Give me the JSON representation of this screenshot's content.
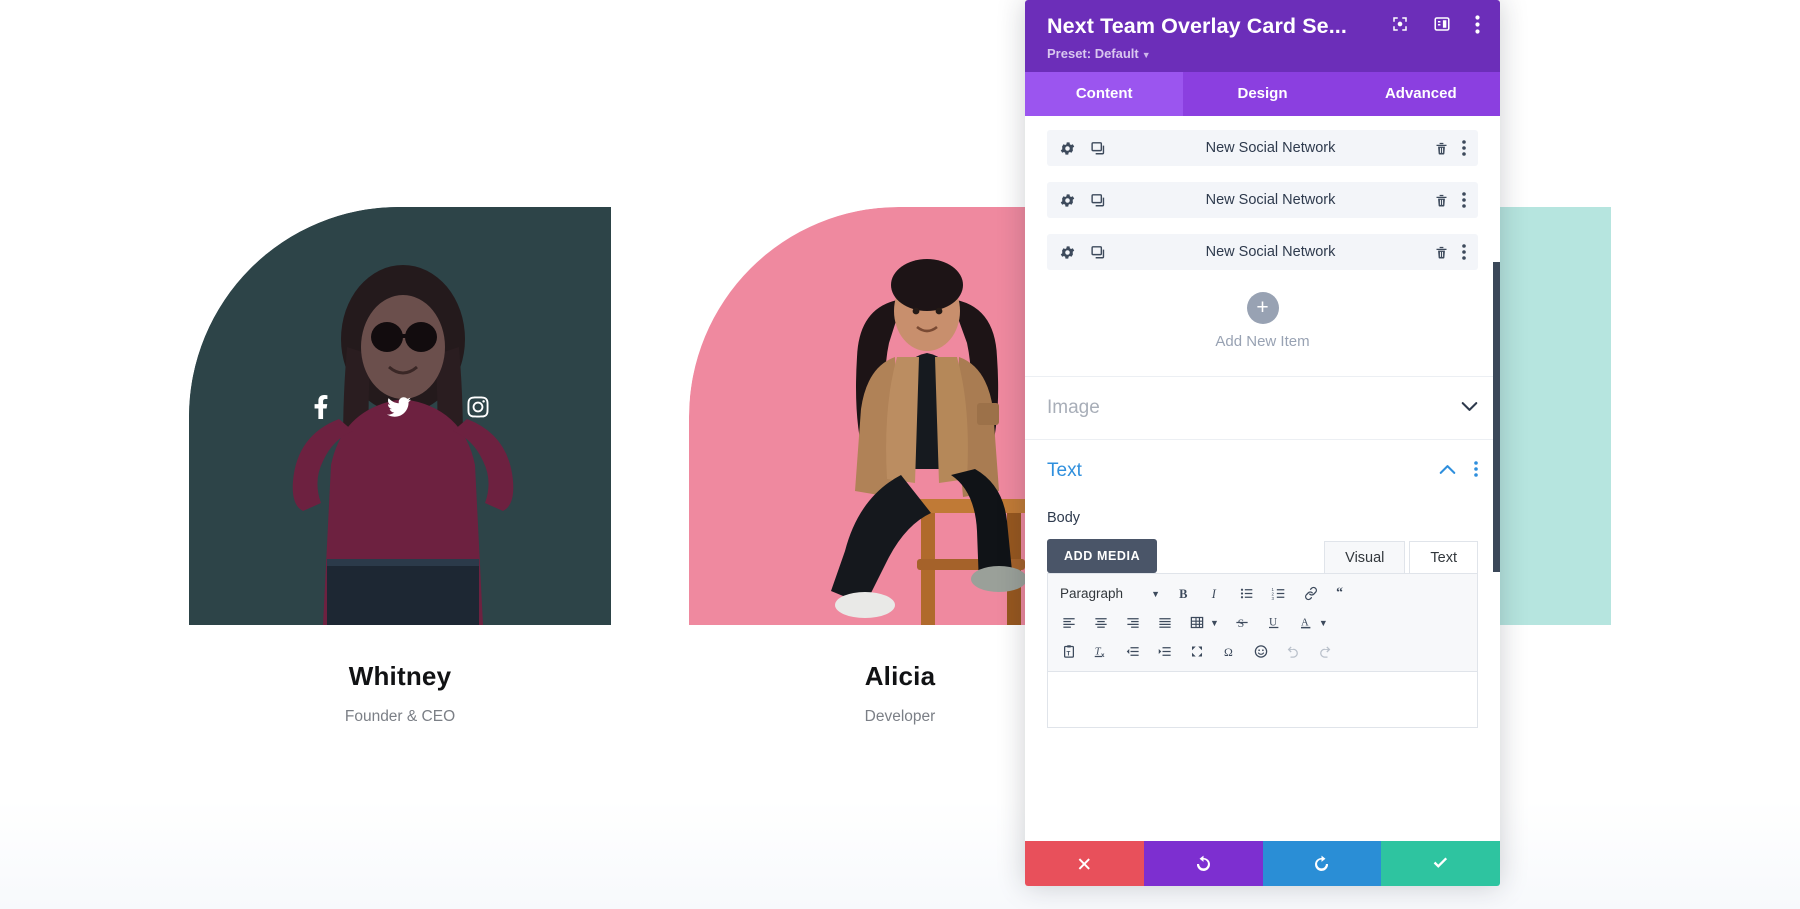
{
  "page": {
    "team_members": [
      {
        "name": "Whitney",
        "role": "Founder & CEO",
        "bg_color": "#2d4448",
        "socials": [
          "facebook-icon",
          "twitter-icon",
          "instagram-icon"
        ]
      },
      {
        "name": "Alicia",
        "role": "Developer",
        "bg_color": "#ef899f",
        "socials": []
      },
      {
        "name": "",
        "role": "",
        "bg_color": "#b6e5df",
        "socials": []
      }
    ]
  },
  "panel": {
    "title": "Next Team Overlay Card Se...",
    "preset_label": "Preset: Default",
    "header_icons": [
      "focus-target-icon",
      "layout-panel-icon",
      "more-vertical-icon"
    ],
    "tabs": [
      {
        "label": "Content",
        "active": true
      },
      {
        "label": "Design",
        "active": false
      },
      {
        "label": "Advanced",
        "active": false
      }
    ],
    "social_items": [
      {
        "label": "New Social Network"
      },
      {
        "label": "New Social Network"
      },
      {
        "label": "New Social Network"
      }
    ],
    "row_icons": [
      "gear-icon",
      "duplicate-icon",
      "trash-icon",
      "more-vertical-icon"
    ],
    "add_new": {
      "label": "Add New Item",
      "plus": "+"
    },
    "sections": [
      {
        "label": "Image",
        "state": "collapsed",
        "chevron": "chevron-down-icon"
      },
      {
        "label": "Text",
        "state": "open",
        "chevron": "chevron-up-icon"
      }
    ],
    "text_section": {
      "field_label": "Body",
      "add_media_label": "ADD MEDIA",
      "editor_tabs": [
        {
          "label": "Visual",
          "active": true
        },
        {
          "label": "Text",
          "active": false
        }
      ],
      "format_select": "Paragraph",
      "toolbar_row1": [
        "bold-icon",
        "italic-icon",
        "bulleted-list-icon",
        "numbered-list-icon",
        "link-icon",
        "blockquote-icon"
      ],
      "toolbar_row2": [
        "align-left-icon",
        "align-center-icon",
        "align-right-icon",
        "align-justify-icon",
        "table-icon",
        "strikethrough-icon",
        "underline-icon",
        "text-color-icon"
      ],
      "toolbar_row3": [
        "paste-as-text-icon",
        "clear-formatting-icon",
        "outdent-icon",
        "indent-icon",
        "fullscreen-icon",
        "special-character-icon",
        "emoji-icon",
        "undo-icon",
        "redo-icon"
      ],
      "body_value": ""
    },
    "actions": [
      {
        "name": "cancel",
        "icon": "close-icon",
        "color": "#e8505b"
      },
      {
        "name": "undo",
        "icon": "undo-icon",
        "color": "#7d2fd0"
      },
      {
        "name": "redo",
        "icon": "redo-icon",
        "color": "#2a8ed6"
      },
      {
        "name": "save",
        "icon": "check-icon",
        "color": "#2ec4a0"
      }
    ]
  },
  "colors": {
    "header_purple": "#6c2eb9",
    "tab_purple": "#8b3fe0",
    "tab_active_purple": "#9b55ef",
    "accent_blue": "#2f8fdd"
  }
}
